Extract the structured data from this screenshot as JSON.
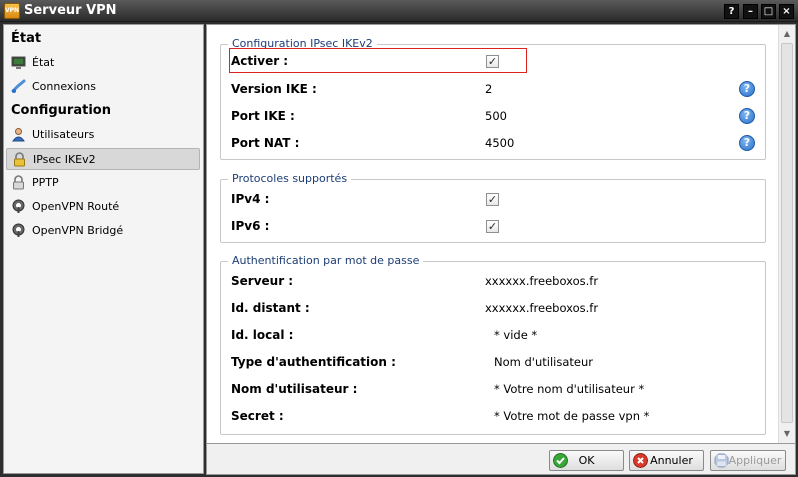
{
  "window": {
    "title": "Serveur VPN",
    "app_icon_text": "VPN",
    "controls": [
      "?",
      "–",
      "□",
      "×"
    ]
  },
  "sidebar": {
    "section_state": "État",
    "section_config": "Configuration",
    "items": [
      {
        "label": "État",
        "icon": "monitor-icon"
      },
      {
        "label": "Connexions",
        "icon": "connection-icon"
      },
      {
        "label": "Utilisateurs",
        "icon": "user-icon"
      },
      {
        "label": "IPsec IKEv2",
        "icon": "lock-icon",
        "active": true
      },
      {
        "label": "PPTP",
        "icon": "lock-icon"
      },
      {
        "label": "OpenVPN Routé",
        "icon": "openvpn-icon"
      },
      {
        "label": "OpenVPN Bridgé",
        "icon": "openvpn-icon"
      }
    ]
  },
  "ipsec": {
    "legend": "Configuration IPsec IKEv2",
    "activer_label": "Activer :",
    "activer_checked": true,
    "version_label": "Version IKE :",
    "version_value": "2",
    "port_ike_label": "Port IKE :",
    "port_ike_value": "500",
    "port_nat_label": "Port NAT :",
    "port_nat_value": "4500",
    "help_glyph": "?"
  },
  "protocols": {
    "legend": "Protocoles supportés",
    "ipv4_label": "IPv4 :",
    "ipv4_checked": true,
    "ipv6_label": "IPv6 :",
    "ipv6_checked": true
  },
  "auth": {
    "legend": "Authentification par mot de passe",
    "serveur_label": "Serveur :",
    "serveur_value": "xxxxxx.freeboxos.fr",
    "id_distant_label": "Id. distant :",
    "id_distant_value": "xxxxxx.freeboxos.fr",
    "id_local_label": "Id. local :",
    "id_local_value": "* vide *",
    "type_label": "Type d'authentification :",
    "type_value": "Nom d'utilisateur",
    "username_label": "Nom d'utilisateur :",
    "username_value": "* Votre nom d'utilisateur *",
    "secret_label": "Secret :",
    "secret_value": "* Votre mot de passe vpn *"
  },
  "footer": {
    "ok_label": "OK",
    "cancel_label": "Annuler",
    "apply_label": "Appliquer"
  },
  "colors": {
    "legend": "#1c3d76",
    "highlight": "#dd2222",
    "help": "#2a6fc9"
  }
}
